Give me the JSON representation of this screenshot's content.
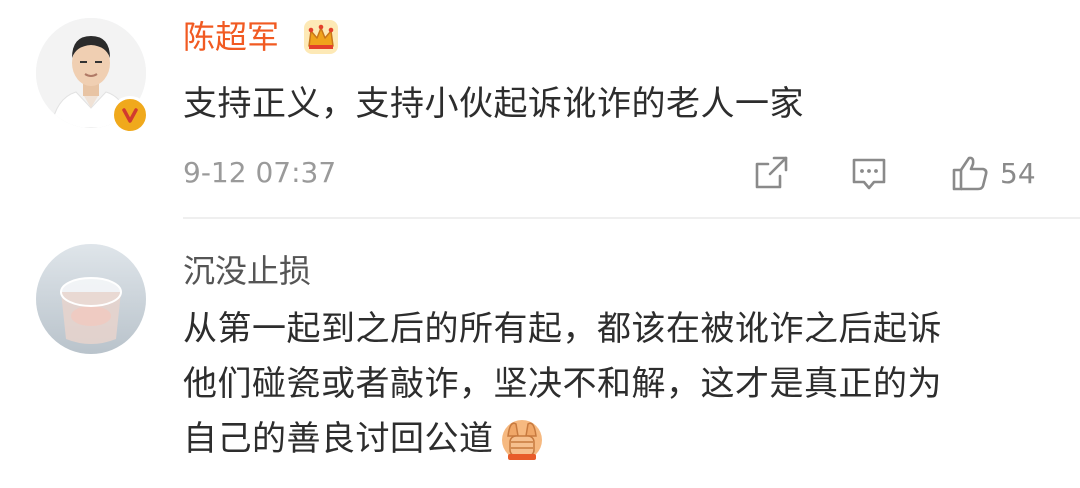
{
  "comments": [
    {
      "username": "陈超军",
      "text": "支持正义，支持小伙起诉讹诈的老人一家",
      "time": "9-12 07:37",
      "likes": "54",
      "verified_badge": "V",
      "badge_color": "#f0a91c",
      "username_color": "#f15a22",
      "has_crown": true
    },
    {
      "username": "沉没止损",
      "text_lines": [
        "从第一起到之后的所有起，都该在被讹诈之后起诉",
        "他们碰瓷或者敲诈，坚决不和解，这才是真正的为",
        "自己的善良讨回公道"
      ],
      "emoji": "fist-bump-emoji",
      "username_color": "#555555"
    }
  ],
  "icons": {
    "share": "share-icon",
    "comment": "comment-icon",
    "like": "like-icon",
    "crown": "crown-icon"
  }
}
